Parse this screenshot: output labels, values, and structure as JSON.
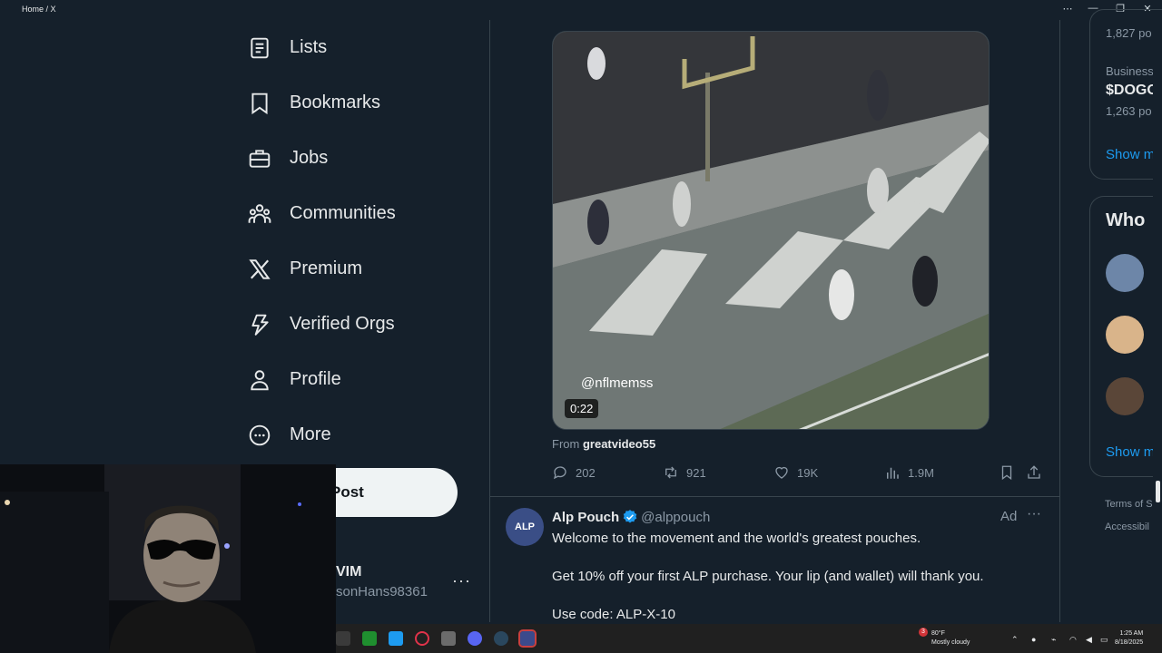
{
  "window": {
    "title": "Home / X",
    "controls": [
      "⋯",
      "—",
      "❐",
      "✕"
    ]
  },
  "nav": {
    "items": [
      {
        "label": "Lists",
        "icon": "list-icon"
      },
      {
        "label": "Bookmarks",
        "icon": "bookmark-icon"
      },
      {
        "label": "Jobs",
        "icon": "briefcase-icon"
      },
      {
        "label": "Communities",
        "icon": "communities-icon"
      },
      {
        "label": "Premium",
        "icon": "x-logo-icon"
      },
      {
        "label": "Verified Orgs",
        "icon": "lightning-icon"
      },
      {
        "label": "Profile",
        "icon": "person-icon"
      },
      {
        "label": "More",
        "icon": "more-circle-icon"
      }
    ],
    "post_label": "Post"
  },
  "account": {
    "name": "VIM",
    "handle": "sonHans98361",
    "more": "···"
  },
  "video": {
    "watermark": "@nflmemss",
    "duration": "0:22"
  },
  "tweet": {
    "from_label": "From",
    "from_source": "greatvideo55",
    "stats": {
      "replies": "202",
      "reposts": "921",
      "likes": "19K",
      "views": "1.9M"
    }
  },
  "ad": {
    "avatar_text": "ALP",
    "name": "Alp Pouch",
    "handle": "@alppouch",
    "tag": "Ad",
    "more": "···",
    "lines": [
      "Welcome to the movement and the world's greatest pouches.",
      "Get 10% off your first ALP purchase. Your lip (and wallet) will thank you.",
      "Use code: ALP-X-10"
    ]
  },
  "sidebar": {
    "trend_count_1": "1,827 po",
    "trend_category": "Business",
    "trend_name": "$DOGO",
    "trend_count_2": "1,263 po",
    "show_more_1": "Show m",
    "who_to_follow": "Who",
    "show_more_2": "Show m",
    "footer_terms": "Terms of S",
    "footer_access": "Accessibil"
  },
  "taskbar": {
    "weather_temp": "80°F",
    "weather_desc": "Mostly cloudy",
    "weather_badge": "3",
    "time": "1:25 AM",
    "date": "8/18/2025"
  }
}
